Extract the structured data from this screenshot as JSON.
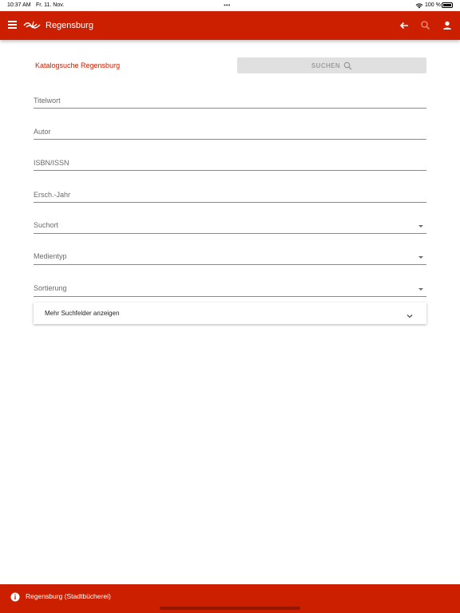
{
  "status_bar": {
    "time": "10:37 AM",
    "date": "Fr. 11. Nov.",
    "dots": "•••",
    "battery": "100 %"
  },
  "app_bar": {
    "title": "Regensburg",
    "menu_icon": "hamburger-icon",
    "logo_icon": "library-logo-icon",
    "back_icon": "arrow-left-icon",
    "search_icon": "search-icon",
    "user_icon": "person-icon"
  },
  "search_header": {
    "title": "Katalogsuche Regensburg",
    "search_button": "SUCHEN"
  },
  "form": {
    "title_word": {
      "placeholder": "Titelwort"
    },
    "author": {
      "placeholder": "Autor"
    },
    "isbn": {
      "placeholder": "ISBN/ISSN"
    },
    "year": {
      "placeholder": "Ersch.-Jahr"
    },
    "location": {
      "label": "Suchort"
    },
    "media_type": {
      "label": "Medientyp"
    },
    "sorting": {
      "label": "Sortierung"
    }
  },
  "more_fields": {
    "label": "Mehr Suchfelder anzeigen"
  },
  "bottom_bar": {
    "label": "Regensburg (Stadtbücherei)",
    "icon": "info-icon"
  },
  "colors": {
    "brand": "#cc1f00",
    "button_bg": "#e0e0e0",
    "button_text": "#9e9e9e"
  }
}
